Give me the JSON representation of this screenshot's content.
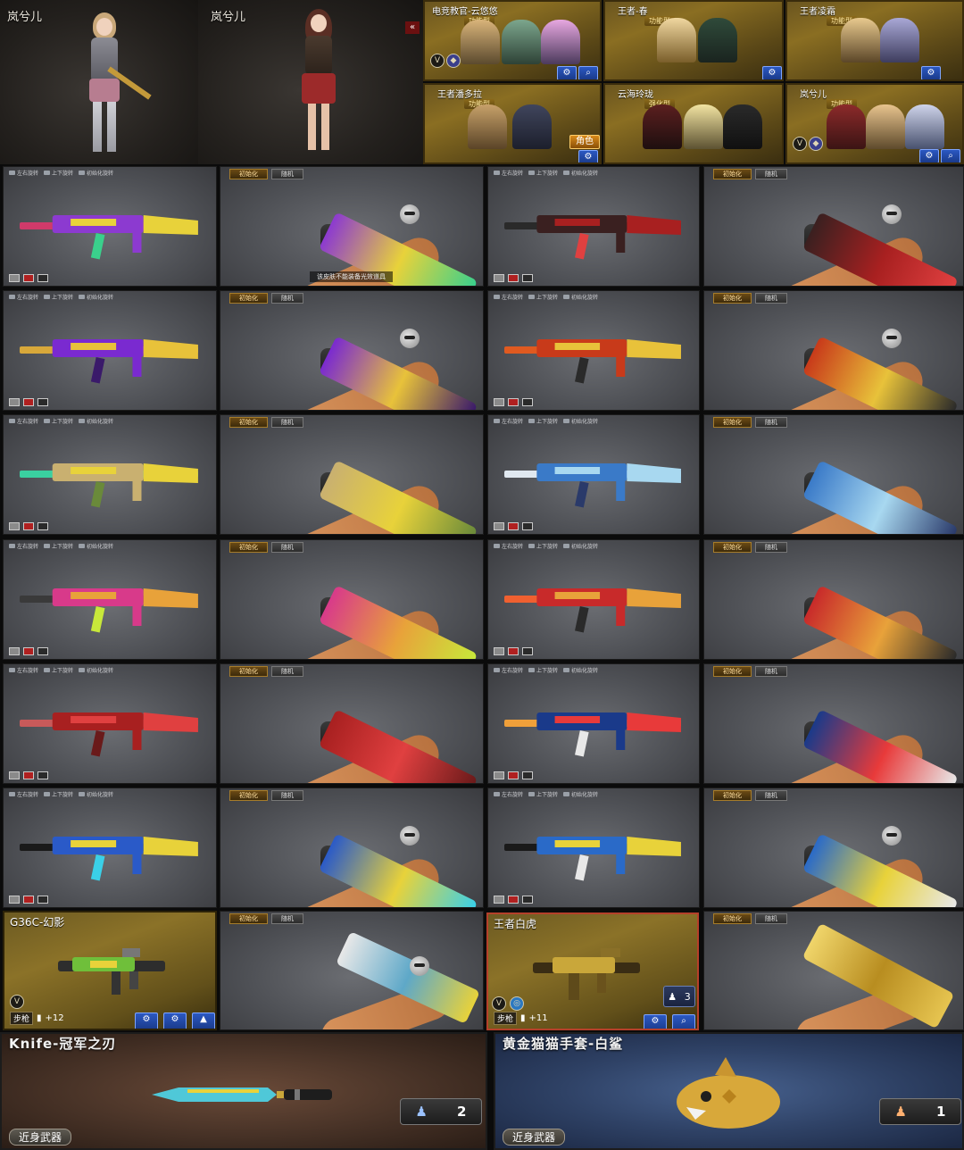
{
  "characters_big": [
    {
      "name": "岚兮儿"
    },
    {
      "name": "岚兮儿"
    }
  ],
  "collapse_icon": "double-chevron-left-icon",
  "character_cards": [
    {
      "title": "电竞教官-云悠悠",
      "tag": "功能型",
      "badge": "V"
    },
    {
      "title": "王者-春",
      "tag": "功能型"
    },
    {
      "title": "王者凌霜",
      "tag": "功能型"
    },
    {
      "title": "王者潘多拉",
      "tag": "功能型"
    },
    {
      "title": "云海玲珑",
      "tag": "强化型"
    },
    {
      "title": "岚兮儿",
      "tag": "功能型",
      "badge": "V"
    }
  ],
  "role_button": "角色",
  "preview_header": {
    "rotate_lr": "左右旋转",
    "rotate_ud": "上下旋转",
    "reset": "初始化旋转"
  },
  "preview_header2": {
    "init": "初始化",
    "random": "随机"
  },
  "preview_caption": "该皮肤不能装备光效道具",
  "weapon_cards": [
    {
      "name": "G36C-幻影",
      "class": "步枪",
      "level": "+12",
      "badge": "V"
    },
    {
      "name": "王者白虎",
      "class": "步枪",
      "level": "+11",
      "badge": "V",
      "count": "3"
    }
  ],
  "melee_cards": [
    {
      "name": "Knife-冠军之刃",
      "tag": "近身武器",
      "count": "2"
    },
    {
      "name": "黄金猫猫手套-白鲨",
      "tag": "近身武器",
      "count": "1"
    }
  ],
  "colors": {
    "gold": "#8a6e22",
    "blue_button": "#2b58c2",
    "preview_bg": "#55575c"
  }
}
